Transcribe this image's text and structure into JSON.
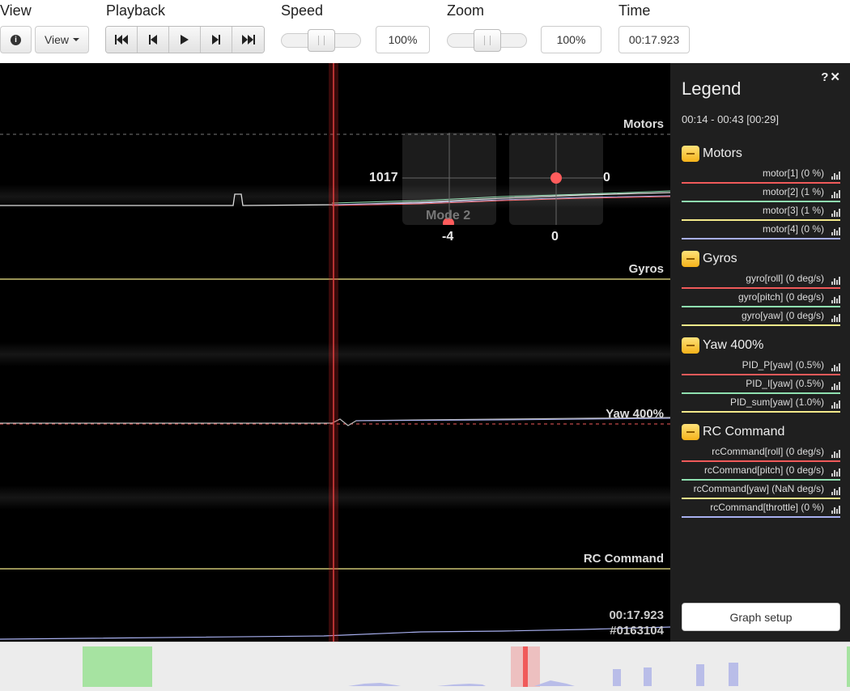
{
  "toolbar": {
    "view_label": "View",
    "view_button": "View",
    "playback_label": "Playback",
    "speed_label": "Speed",
    "speed_value": "100%",
    "zoom_label": "Zoom",
    "zoom_value": "100%",
    "time_label": "Time",
    "time_value": "00:17.923",
    "speed_level": 0.5,
    "zoom_level": 0.5
  },
  "graph": {
    "labels": {
      "motors": "Motors",
      "gyros": "Gyros",
      "yaw": "Yaw 400%",
      "rc": "RC Command"
    },
    "sticks": {
      "left_value_1": "1017",
      "left_value_2": "-4",
      "right_value_1": "0",
      "right_value_2": "0",
      "mode": "Mode 2"
    },
    "readout_time": "00:17.923",
    "readout_frame": "#0163104"
  },
  "legend": {
    "title": "Legend",
    "range": "00:14 - 00:43 [00:29]",
    "groups": [
      {
        "name": "Motors",
        "fields": [
          "motor[1] (0 %)",
          "motor[2] (1 %)",
          "motor[3] (1 %)",
          "motor[4] (0 %)"
        ]
      },
      {
        "name": "Gyros",
        "fields": [
          "gyro[roll] (0 deg/s)",
          "gyro[pitch] (0 deg/s)",
          "gyro[yaw] (0 deg/s)"
        ]
      },
      {
        "name": "Yaw 400%",
        "fields": [
          "PID_P[yaw] (0.5%)",
          "PID_I[yaw] (0.5%)",
          "PID_sum[yaw] (1.0%)"
        ]
      },
      {
        "name": "RC Command",
        "fields": [
          "rcCommand[roll] (0 deg/s)",
          "rcCommand[pitch] (0 deg/s)",
          "rcCommand[yaw] (NaN deg/s)",
          "rcCommand[throttle] (0 %)"
        ]
      }
    ],
    "graph_setup": "Graph setup"
  },
  "colors": {
    "series_1": "#f05a5a",
    "series_2": "#8fe0b0",
    "series_3": "#f3e98a",
    "series_4": "#a8b0f0",
    "cursor": "#e04040",
    "legend_bg": "#1f1f1f",
    "overview_green": "#a6e3a1"
  }
}
